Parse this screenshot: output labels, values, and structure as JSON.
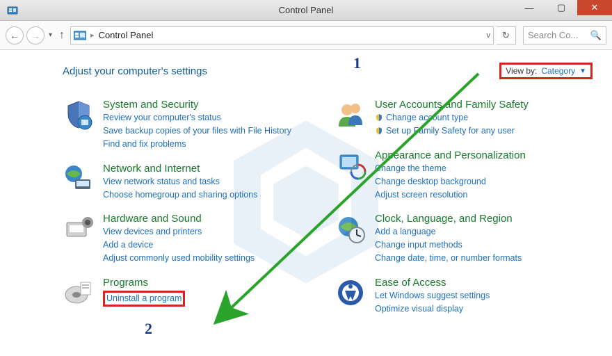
{
  "window": {
    "title": "Control Panel"
  },
  "nav": {
    "crumb": "Control Panel",
    "search_placeholder": "Search Co..."
  },
  "page": {
    "heading": "Adjust your computer's settings",
    "viewby_label": "View by:",
    "viewby_value": "Category"
  },
  "left": [
    {
      "title": "System and Security",
      "links": [
        "Review your computer's status",
        "Save backup copies of your files with File History",
        "Find and fix problems"
      ]
    },
    {
      "title": "Network and Internet",
      "links": [
        "View network status and tasks",
        "Choose homegroup and sharing options"
      ]
    },
    {
      "title": "Hardware and Sound",
      "links": [
        "View devices and printers",
        "Add a device",
        "Adjust commonly used mobility settings"
      ]
    },
    {
      "title": "Programs",
      "links": [
        "Uninstall a program"
      ]
    }
  ],
  "right": [
    {
      "title": "User Accounts and Family Safety",
      "links": [
        "Change account type",
        "Set up Family Safety for any user"
      ],
      "shield": [
        true,
        true
      ]
    },
    {
      "title": "Appearance and Personalization",
      "links": [
        "Change the theme",
        "Change desktop background",
        "Adjust screen resolution"
      ]
    },
    {
      "title": "Clock, Language, and Region",
      "links": [
        "Add a language",
        "Change input methods",
        "Change date, time, or number formats"
      ]
    },
    {
      "title": "Ease of Access",
      "links": [
        "Let Windows suggest settings",
        "Optimize visual display"
      ]
    }
  ],
  "annot": {
    "n1": "1",
    "n2": "2"
  }
}
